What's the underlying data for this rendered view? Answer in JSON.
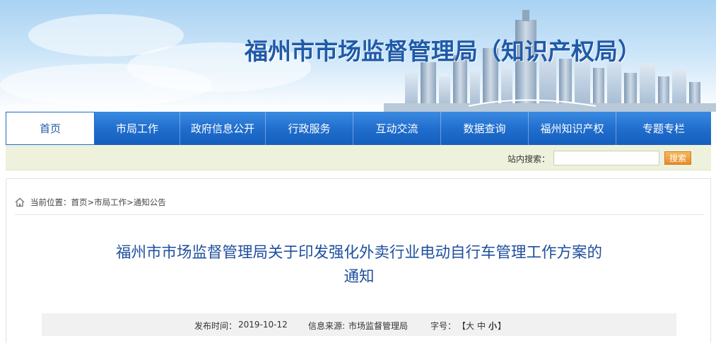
{
  "site": {
    "title": "福州市市场监督管理局（知识产权局）"
  },
  "nav": {
    "items": [
      "首页",
      "市局工作",
      "政府信息公开",
      "行政服务",
      "互动交流",
      "数据查询",
      "福州知识产权",
      "专题专栏"
    ],
    "active_index": 0
  },
  "search": {
    "label": "站内搜索：",
    "value": "",
    "button_label": "搜索"
  },
  "breadcrumb": {
    "prefix": "当前位置：",
    "items": [
      "首页",
      "市局工作",
      "通知公告"
    ],
    "separator": ">"
  },
  "article": {
    "title_line1": "福州市市场监督管理局关于印发强化外卖行业电动自行车管理工作方案的",
    "title_line2": "通知",
    "publish_label": "发布时间：",
    "publish_date": "2019-10-12",
    "source_label": "信息来源:",
    "source_value": "市场监督管理局",
    "fontsize_label": "字号：",
    "bracket_open": "【",
    "size_large": "大",
    "size_medium": "中",
    "size_small": "小",
    "bracket_close": "】"
  },
  "colors": {
    "nav_blue": "#1f6ccc",
    "title_blue": "#1f5aa8",
    "article_title_blue": "#1f4f9e",
    "search_button": "#e8892c",
    "searchbar_bg": "#eef2dc"
  }
}
